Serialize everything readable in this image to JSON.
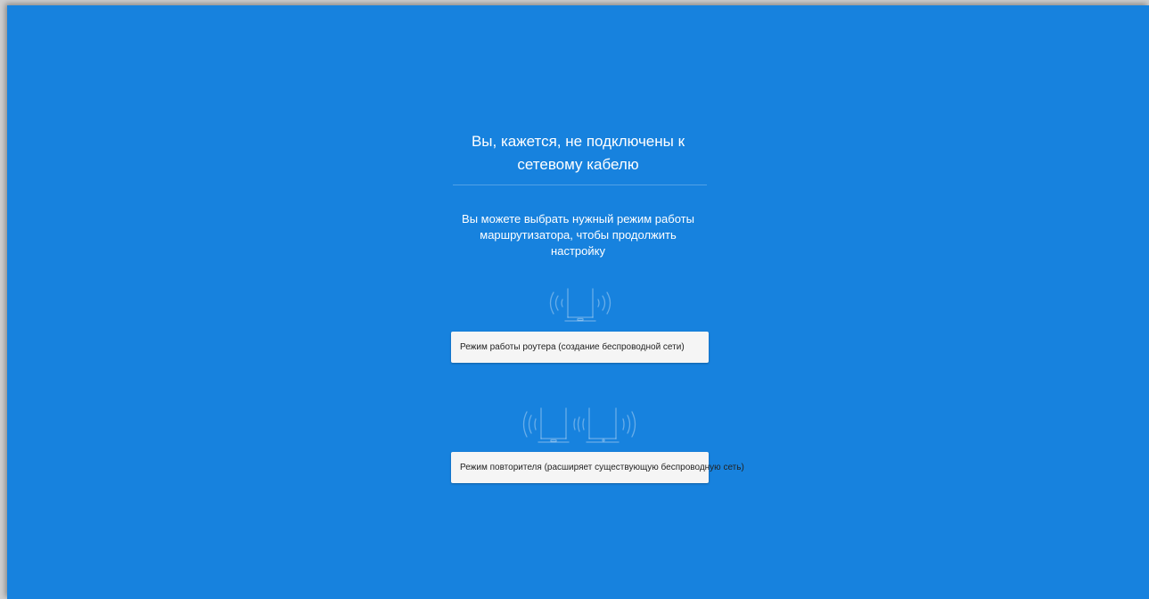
{
  "title": {
    "line1": "Вы, кажется, не подключены к",
    "line2": "сетевому кабелю"
  },
  "subtitle": {
    "line1": "Вы можете выбрать нужный режим работы",
    "line2": "маршрутизатора, чтобы продолжить",
    "line3": "настройку"
  },
  "modes": {
    "router": {
      "label": "Режим работы роутера (создание беспроводной сети)",
      "icon": "router-wifi-icon"
    },
    "repeater": {
      "label": "Режим повторителя (расширяет существующую беспроводную сеть)",
      "icon": "repeater-wifi-icon"
    }
  },
  "colors": {
    "background": "#1782de",
    "button_bg": "#f5f5f5",
    "text": "#ffffff"
  }
}
